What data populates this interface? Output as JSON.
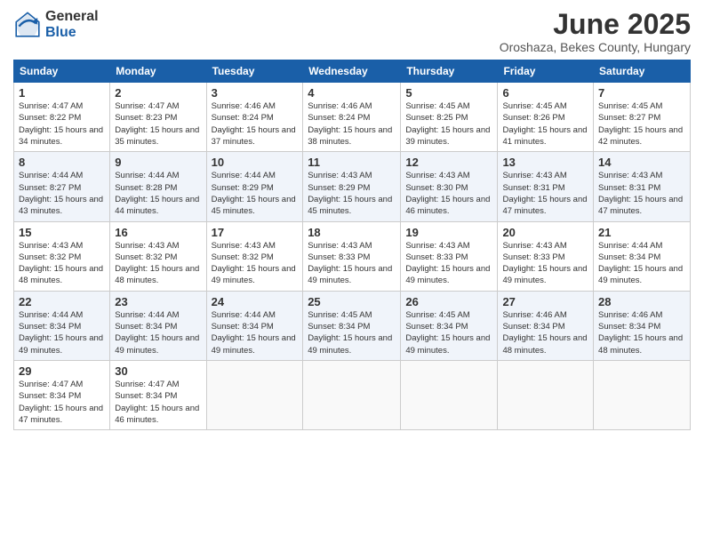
{
  "logo": {
    "general": "General",
    "blue": "Blue"
  },
  "title": "June 2025",
  "subtitle": "Oroshaza, Bekes County, Hungary",
  "days_of_week": [
    "Sunday",
    "Monday",
    "Tuesday",
    "Wednesday",
    "Thursday",
    "Friday",
    "Saturday"
  ],
  "weeks": [
    [
      {
        "day": "1",
        "sunrise": "4:47 AM",
        "sunset": "8:22 PM",
        "daylight": "15 hours and 34 minutes."
      },
      {
        "day": "2",
        "sunrise": "4:47 AM",
        "sunset": "8:23 PM",
        "daylight": "15 hours and 35 minutes."
      },
      {
        "day": "3",
        "sunrise": "4:46 AM",
        "sunset": "8:24 PM",
        "daylight": "15 hours and 37 minutes."
      },
      {
        "day": "4",
        "sunrise": "4:46 AM",
        "sunset": "8:24 PM",
        "daylight": "15 hours and 38 minutes."
      },
      {
        "day": "5",
        "sunrise": "4:45 AM",
        "sunset": "8:25 PM",
        "daylight": "15 hours and 39 minutes."
      },
      {
        "day": "6",
        "sunrise": "4:45 AM",
        "sunset": "8:26 PM",
        "daylight": "15 hours and 41 minutes."
      },
      {
        "day": "7",
        "sunrise": "4:45 AM",
        "sunset": "8:27 PM",
        "daylight": "15 hours and 42 minutes."
      }
    ],
    [
      {
        "day": "8",
        "sunrise": "4:44 AM",
        "sunset": "8:27 PM",
        "daylight": "15 hours and 43 minutes."
      },
      {
        "day": "9",
        "sunrise": "4:44 AM",
        "sunset": "8:28 PM",
        "daylight": "15 hours and 44 minutes."
      },
      {
        "day": "10",
        "sunrise": "4:44 AM",
        "sunset": "8:29 PM",
        "daylight": "15 hours and 45 minutes."
      },
      {
        "day": "11",
        "sunrise": "4:43 AM",
        "sunset": "8:29 PM",
        "daylight": "15 hours and 45 minutes."
      },
      {
        "day": "12",
        "sunrise": "4:43 AM",
        "sunset": "8:30 PM",
        "daylight": "15 hours and 46 minutes."
      },
      {
        "day": "13",
        "sunrise": "4:43 AM",
        "sunset": "8:31 PM",
        "daylight": "15 hours and 47 minutes."
      },
      {
        "day": "14",
        "sunrise": "4:43 AM",
        "sunset": "8:31 PM",
        "daylight": "15 hours and 47 minutes."
      }
    ],
    [
      {
        "day": "15",
        "sunrise": "4:43 AM",
        "sunset": "8:32 PM",
        "daylight": "15 hours and 48 minutes."
      },
      {
        "day": "16",
        "sunrise": "4:43 AM",
        "sunset": "8:32 PM",
        "daylight": "15 hours and 48 minutes."
      },
      {
        "day": "17",
        "sunrise": "4:43 AM",
        "sunset": "8:32 PM",
        "daylight": "15 hours and 49 minutes."
      },
      {
        "day": "18",
        "sunrise": "4:43 AM",
        "sunset": "8:33 PM",
        "daylight": "15 hours and 49 minutes."
      },
      {
        "day": "19",
        "sunrise": "4:43 AM",
        "sunset": "8:33 PM",
        "daylight": "15 hours and 49 minutes."
      },
      {
        "day": "20",
        "sunrise": "4:43 AM",
        "sunset": "8:33 PM",
        "daylight": "15 hours and 49 minutes."
      },
      {
        "day": "21",
        "sunrise": "4:44 AM",
        "sunset": "8:34 PM",
        "daylight": "15 hours and 49 minutes."
      }
    ],
    [
      {
        "day": "22",
        "sunrise": "4:44 AM",
        "sunset": "8:34 PM",
        "daylight": "15 hours and 49 minutes."
      },
      {
        "day": "23",
        "sunrise": "4:44 AM",
        "sunset": "8:34 PM",
        "daylight": "15 hours and 49 minutes."
      },
      {
        "day": "24",
        "sunrise": "4:44 AM",
        "sunset": "8:34 PM",
        "daylight": "15 hours and 49 minutes."
      },
      {
        "day": "25",
        "sunrise": "4:45 AM",
        "sunset": "8:34 PM",
        "daylight": "15 hours and 49 minutes."
      },
      {
        "day": "26",
        "sunrise": "4:45 AM",
        "sunset": "8:34 PM",
        "daylight": "15 hours and 49 minutes."
      },
      {
        "day": "27",
        "sunrise": "4:46 AM",
        "sunset": "8:34 PM",
        "daylight": "15 hours and 48 minutes."
      },
      {
        "day": "28",
        "sunrise": "4:46 AM",
        "sunset": "8:34 PM",
        "daylight": "15 hours and 48 minutes."
      }
    ],
    [
      {
        "day": "29",
        "sunrise": "4:47 AM",
        "sunset": "8:34 PM",
        "daylight": "15 hours and 47 minutes."
      },
      {
        "day": "30",
        "sunrise": "4:47 AM",
        "sunset": "8:34 PM",
        "daylight": "15 hours and 46 minutes."
      },
      null,
      null,
      null,
      null,
      null
    ]
  ]
}
